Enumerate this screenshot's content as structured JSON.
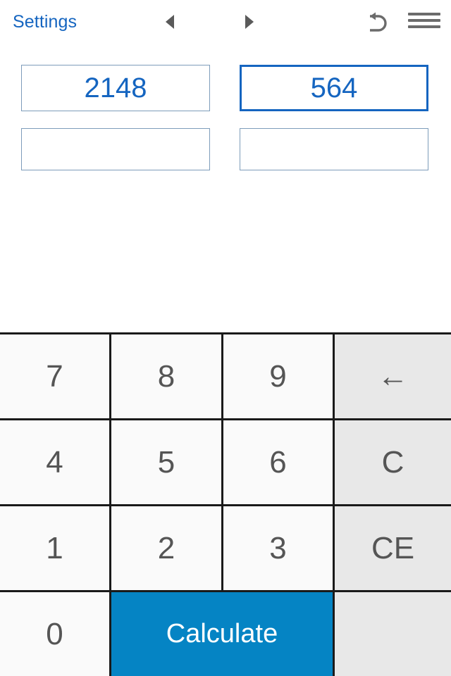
{
  "toolbar": {
    "settings_label": "Settings",
    "prev_icon": "triangle-left-icon",
    "next_icon": "triangle-right-icon",
    "undo_icon": "undo-arrow-icon",
    "menu_icon": "hamburger-menu-icon"
  },
  "fields": {
    "row1": [
      {
        "value": "2148",
        "placeholder": "",
        "focused": false
      },
      {
        "value": "564",
        "placeholder": "",
        "focused": true
      }
    ],
    "row2": [
      {
        "value": "",
        "placeholder": "",
        "focused": false
      },
      {
        "value": "",
        "placeholder": "",
        "focused": false
      }
    ]
  },
  "keypad": {
    "keys": [
      {
        "label": "7",
        "style": "light"
      },
      {
        "label": "8",
        "style": "light"
      },
      {
        "label": "9",
        "style": "light"
      },
      {
        "label": "←",
        "style": "gray",
        "name": "backspace-key"
      },
      {
        "label": "4",
        "style": "light"
      },
      {
        "label": "5",
        "style": "light"
      },
      {
        "label": "6",
        "style": "light"
      },
      {
        "label": "C",
        "style": "gray",
        "name": "clear-key"
      },
      {
        "label": "1",
        "style": "light"
      },
      {
        "label": "2",
        "style": "light"
      },
      {
        "label": "3",
        "style": "light"
      },
      {
        "label": "CE",
        "style": "gray",
        "name": "clear-entry-key"
      },
      {
        "label": "0",
        "style": "light"
      },
      {
        "label": "Calculate",
        "style": "accent",
        "name": "calculate-button"
      },
      {
        "label": "",
        "style": "gray",
        "name": "blank-key"
      }
    ]
  },
  "colors": {
    "accent_blue": "#0584c4",
    "link_blue": "#1565c0",
    "field_border": "#7d9cba",
    "field_border_focused": "#1565c0",
    "key_light": "#fafafa",
    "key_gray": "#e8e8e8",
    "key_text": "#555555",
    "grid_line": "#1a1a1a",
    "icon_gray": "#5a5a5a"
  }
}
